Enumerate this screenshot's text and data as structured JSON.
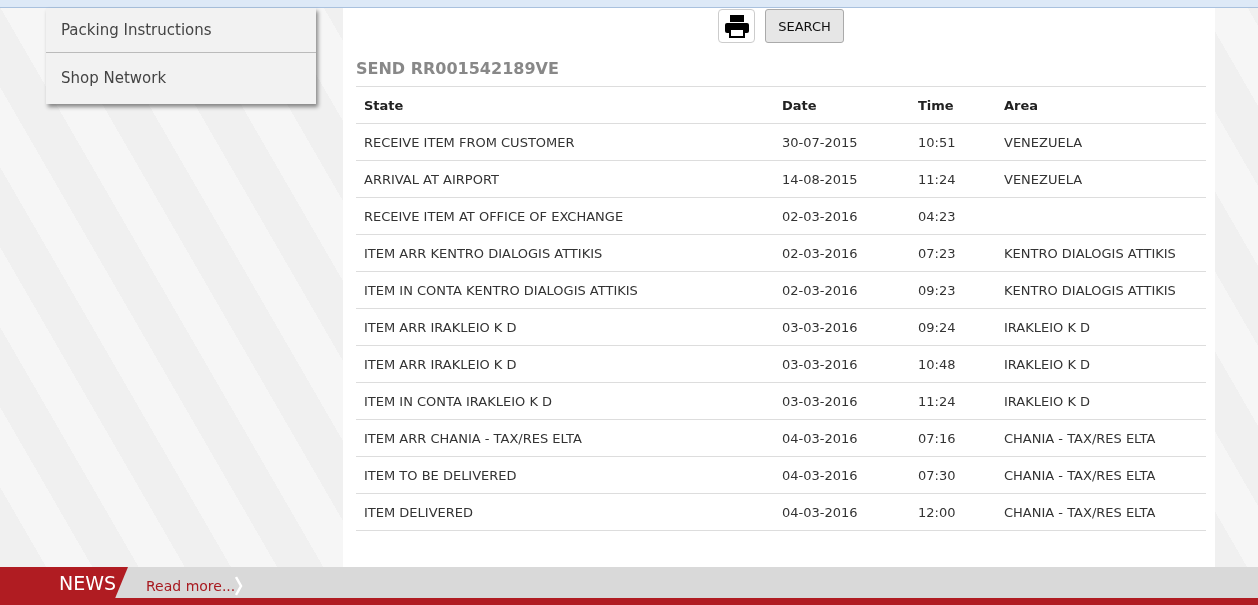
{
  "menu": [
    {
      "label": "Packing Instructions"
    },
    {
      "label": "Shop Network"
    }
  ],
  "toolbar": {
    "search_button": "SEARCH"
  },
  "title": "SEND RR001542189VE",
  "table": {
    "columns": [
      "State",
      "Date",
      "Time",
      "Area"
    ],
    "rows": [
      [
        "RECEIVE ITEM FROM CUSTOMER",
        "30-07-2015",
        "10:51",
        "VENEZUELA"
      ],
      [
        "ARRIVAL AT AIRPORT",
        "14-08-2015",
        "11:24",
        "VENEZUELA"
      ],
      [
        "RECEIVE ITEM AT OFFICE OF EXCHANGE",
        "02-03-2016",
        "04:23",
        ""
      ],
      [
        "ITEM ARR KENTRO DIALOGIS ATTIKIS",
        "02-03-2016",
        "07:23",
        "KENTRO DIALOGIS ATTIKIS"
      ],
      [
        "ITEM IN CONTA KENTRO DIALOGIS ATTIKIS",
        "02-03-2016",
        "09:23",
        "KENTRO DIALOGIS ATTIKIS"
      ],
      [
        "ITEM ARR IRAKLEIO K D",
        "03-03-2016",
        "09:24",
        "IRAKLEIO K D"
      ],
      [
        "ITEM ARR IRAKLEIO K D",
        "03-03-2016",
        "10:48",
        "IRAKLEIO K D"
      ],
      [
        "ITEM IN CONTA IRAKLEIO K D",
        "03-03-2016",
        "11:24",
        "IRAKLEIO K D"
      ],
      [
        "ITEM ARR CHANIA - TAX/RES ELTA",
        "04-03-2016",
        "07:16",
        "CHANIA - TAX/RES ELTA"
      ],
      [
        "ITEM TO BE DELIVERED",
        "04-03-2016",
        "07:30",
        "CHANIA - TAX/RES ELTA"
      ],
      [
        "ITEM DELIVERED",
        "04-03-2016",
        "12:00",
        "CHANIA - TAX/RES ELTA"
      ]
    ]
  },
  "news": {
    "label": "NEWS",
    "link": "Read more..."
  }
}
